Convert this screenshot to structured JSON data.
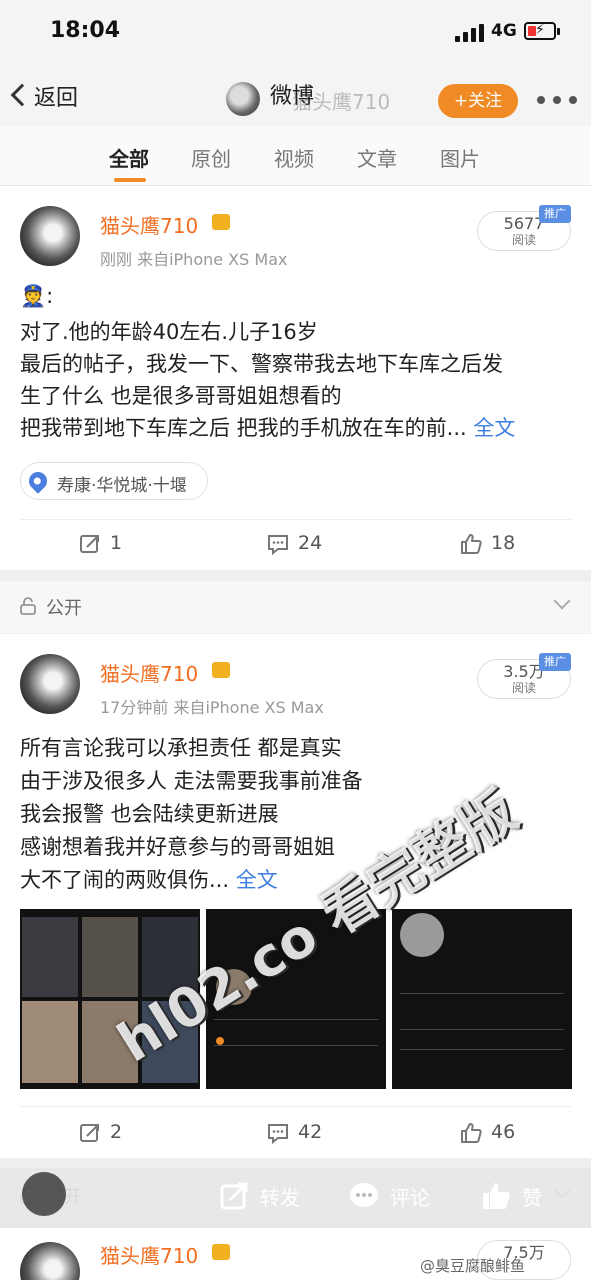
{
  "status": {
    "time": "18:04",
    "network": "4G"
  },
  "nav": {
    "back": "返回",
    "title": "微博",
    "subtitle": "猫头鹰710",
    "follow": "+关注"
  },
  "tabs": [
    "全部",
    "原创",
    "视频",
    "文章",
    "图片"
  ],
  "post1": {
    "username": "猫头鹰710",
    "meta": "刚刚  来自iPhone XS Max",
    "reads": "5677",
    "reads_label": "阅读",
    "promo": "推广",
    "lines": [
      "👮:",
      "对了.他的年龄40左右.儿子16岁",
      "最后的帖子，我发一下、警察带我去地下车库之后发",
      "生了什么 也是很多哥哥姐姐想看的",
      "把我带到地下车库之后 把我的手机放在车的前..."
    ],
    "full_text": "全文",
    "location": "寿康·华悦城·十堰",
    "repost": "1",
    "comments": "24",
    "likes": "18"
  },
  "public1": "公开",
  "post2": {
    "username": "猫头鹰710",
    "meta": "17分钟前  来自iPhone XS Max",
    "reads": "3.5万",
    "reads_label": "阅读",
    "promo": "推广",
    "lines": [
      "所有言论我可以承担责任 都是真实",
      "由于涉及很多人 走法需要我事前准备",
      "我会报警 也会陆续更新进展",
      "感谢想着我并好意参与的哥哥姐姐",
      "大不了闹的两败俱伤..."
    ],
    "full_text": "全文",
    "repost": "2",
    "comments": "42",
    "likes": "46"
  },
  "public2": "公开",
  "bottom": {
    "repost": "转发",
    "comment": "评论",
    "like": "赞"
  },
  "post3": {
    "username": "猫头鹰710",
    "reads": "7.5万"
  },
  "watermark": "hl02.co 看完整版",
  "credit": "@臭豆腐酿鲱鱼",
  "colors": {
    "accent": "#f08a24",
    "username": "#f36e20",
    "link": "#3d7de0"
  }
}
